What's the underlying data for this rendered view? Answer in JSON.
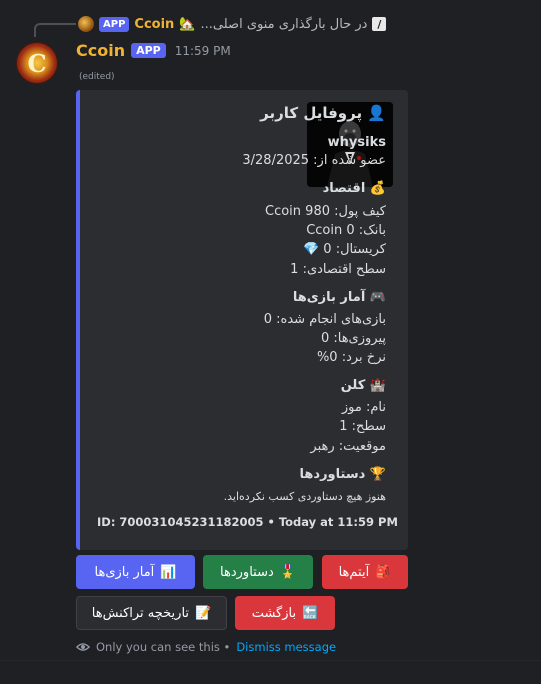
{
  "reply": {
    "app_badge": "APP",
    "author": "Ccoin",
    "emoji": "🏡",
    "text": "...در حال بارگذاری منوی اصلی",
    "icon_glyph": "/"
  },
  "message": {
    "author": "Ccoin",
    "app_badge": "APP",
    "avatar_letter": "C",
    "timestamp": "11:59 PM",
    "edited": "(edited)"
  },
  "embed": {
    "accent_color": "#5865f2",
    "title": "👤 پروفایل کاربر",
    "username": "whysiks",
    "joined": "عضو شده از: 3/28/2025",
    "economy_title": "💰 اقتصاد",
    "wallet": "کیف پول: 980 Ccoin",
    "bank": "بانک: 0 Ccoin",
    "crystal": "کریستال: 0 💎",
    "econ_level": "سطح اقتصادی: 1",
    "games_title": "🎮 آمار بازی‌ها",
    "games_played": "بازی‌های انجام شده: 0",
    "wins": "پیروزی‌ها: 0",
    "win_rate": "نرخ برد: 0%",
    "clan_title": "🏰 کلن",
    "clan_name": "نام: موز",
    "clan_level": "سطح: 1",
    "clan_role": "موقعیت: رهبر",
    "achievements_title": "🏆 دستاوردها",
    "achievements_text": "هنوز هیچ دستاوردی کسب نکرده‌اید.",
    "footer": "ID: 700031045231182005 • Today at 11:59 PM"
  },
  "buttons": {
    "game_stats": {
      "label": "آمار بازی‌ها",
      "emoji": "📊"
    },
    "achievements": {
      "label": "دستاوردها",
      "emoji": "🎖️"
    },
    "items": {
      "label": "آیتم‌ها",
      "emoji": "🎒"
    },
    "transactions": {
      "label": "تاریخچه تراکنش‌ها",
      "emoji": "📝"
    },
    "back": {
      "label": "بازگشت",
      "emoji": "🔙"
    }
  },
  "ephemeral": {
    "text": "Only you can see this •",
    "dismiss": "Dismiss message"
  }
}
